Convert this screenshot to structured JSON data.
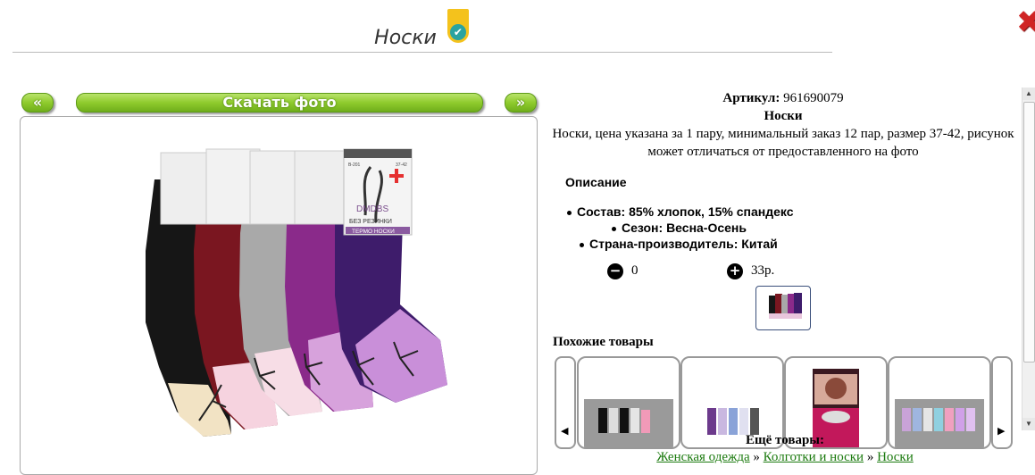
{
  "modal": {
    "title": "Носки",
    "close_glyph": "✖",
    "badge_glyph": "✔"
  },
  "gallery": {
    "prev_label": "«",
    "download_label": "Скачать фото",
    "next_label": "»"
  },
  "product": {
    "article_label": "Артикул:",
    "article_value": "961690079",
    "name": "Носки",
    "summary": "Носки, цена указана за 1 пару, минимальный заказ 12 пар, размер 37-42, рисунок может отличаться от предоставленного на фото",
    "description_heading": "Описание",
    "specs": [
      "Состав: 85% хлопок, 15% спандекс",
      "Сезон: Весна-Осень",
      "Страна-производитель: Китай"
    ],
    "quantity": "0",
    "price": "33р.",
    "minus_glyph": "−",
    "plus_glyph": "+"
  },
  "similar": {
    "heading": "Похожие товары",
    "left_arrow": "◀",
    "right_arrow": "▶"
  },
  "more": {
    "heading": "Ещё товары:",
    "crumbs": [
      "Женская одежда",
      "Колготки и носки",
      "Носки"
    ],
    "separator": "»"
  },
  "socks_packaging": {
    "brand": "DMDBS",
    "line1": "БЕЗ РЕЗИНКИ",
    "line2": "ТЕРМО НОСКИ",
    "code": "B-201",
    "size": "37-42"
  },
  "colors": {
    "accent_green": "#8fcb2d",
    "link_green": "#1b7a0e",
    "close_red": "#d02424"
  },
  "icons": {
    "close": "close-icon",
    "badge": "verified-badge-icon",
    "minus": "minus-circle-icon",
    "plus": "plus-circle-icon"
  }
}
